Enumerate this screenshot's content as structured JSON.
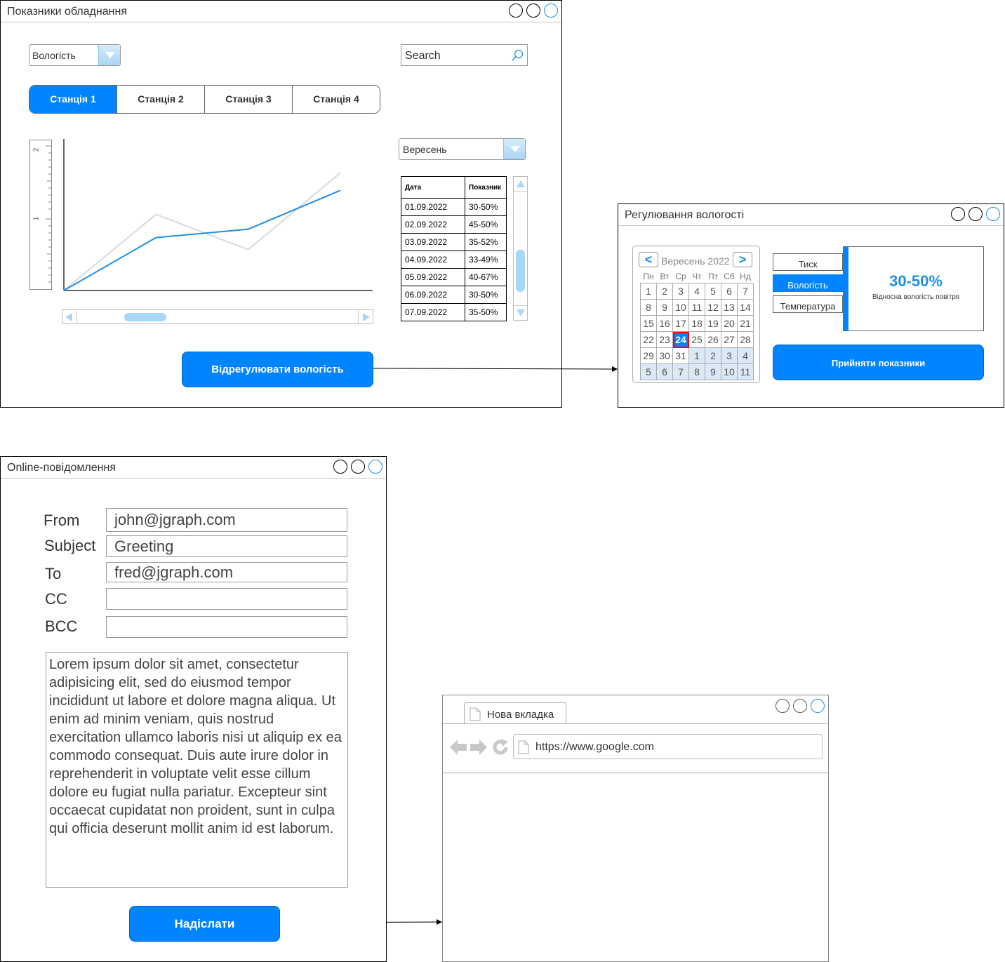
{
  "window1": {
    "title": "Показники обладнання",
    "param_select": "Вологість",
    "search": {
      "placeholder": "Search"
    },
    "tabs": [
      {
        "label": "Станція 1",
        "active": true
      },
      {
        "label": "Станція 2",
        "active": false
      },
      {
        "label": "Станція 3",
        "active": false
      },
      {
        "label": "Станція 4",
        "active": false
      }
    ],
    "ruler_ticks": [
      "2",
      "1"
    ],
    "month_select": "Вересень",
    "table": {
      "headers": [
        "Дата",
        "Показник"
      ],
      "rows": [
        [
          "01.09.2022",
          "30-50%"
        ],
        [
          "02.09.2022",
          "45-50%"
        ],
        [
          "03.09.2022",
          "35-52%"
        ],
        [
          "04.09.2022",
          "33-49%"
        ],
        [
          "05.09.2022",
          "40-67%"
        ],
        [
          "06.09.2022",
          "30-50%"
        ],
        [
          "07.09.2022",
          "35-50%"
        ]
      ]
    },
    "adjust_button": "Відрегулювати вологість"
  },
  "chart_data": {
    "type": "line",
    "x": [
      0,
      1,
      2,
      3
    ],
    "series": [
      {
        "values": [
          0,
          0.75,
          0.87,
          1.42
        ],
        "color": "#1e90e6"
      },
      {
        "values": [
          0,
          1.08,
          0.58,
          1.67
        ],
        "color": "#d9d9d9"
      }
    ],
    "ylim": [
      0,
      2.15
    ],
    "xlim": [
      0,
      3.35
    ],
    "grid": false
  },
  "window2": {
    "title": "Регулювання вологості",
    "calendar": {
      "month": "Вересень 2022",
      "weekdays": [
        "Пн",
        "Вт",
        "Ср",
        "Чт",
        "Пт",
        "Сб",
        "Нд"
      ],
      "weeks": [
        [
          "1",
          "2",
          "3",
          "4",
          "5",
          "6",
          "7"
        ],
        [
          "8",
          "9",
          "10",
          "11",
          "12",
          "13",
          "14"
        ],
        [
          "15",
          "16",
          "17",
          "18",
          "19",
          "20",
          "21"
        ],
        [
          "22",
          "23",
          "24",
          "25",
          "26",
          "27",
          "28"
        ],
        [
          "29",
          "30",
          "31",
          "1",
          "2",
          "3",
          "4"
        ],
        [
          "5",
          "6",
          "7",
          "8",
          "9",
          "10",
          "11"
        ]
      ],
      "selected": "24"
    },
    "params": [
      "Тиск",
      "Вологість",
      "Температура"
    ],
    "active_param": "Вологість",
    "value": "30-50%",
    "value_caption": "Відносна вологість повітря",
    "accept_button": "Прийняти показники"
  },
  "window3": {
    "title": "Online-повідомлення",
    "fields": [
      {
        "label": "From",
        "value": "john@jgraph.com"
      },
      {
        "label": "Subject",
        "value": "Greeting"
      },
      {
        "label": "To",
        "value": "fred@jgraph.com"
      },
      {
        "label": "CC",
        "value": ""
      },
      {
        "label": "BCC",
        "value": ""
      }
    ],
    "body": "Lorem ipsum dolor sit amet, consectetur adipisicing elit, sed do eiusmod tempor incididunt ut labore et dolore magna aliqua. Ut enim ad minim veniam, quis nostrud exercitation ullamco laboris nisi ut aliquip ex ea commodo consequat. Duis aute irure dolor in reprehenderit in voluptate velit esse cillum dolore eu fugiat nulla pariatur. Excepteur sint occaecat cupidatat non proident, sunt in culpa qui officia deserunt mollit anim id est laborum.",
    "send_button": "Надіслати"
  },
  "window4": {
    "tab_label": "Нова вкладка",
    "url": "https://www.google.com"
  },
  "colors": {
    "accent": "#0084ff",
    "window_border": "#000000"
  }
}
